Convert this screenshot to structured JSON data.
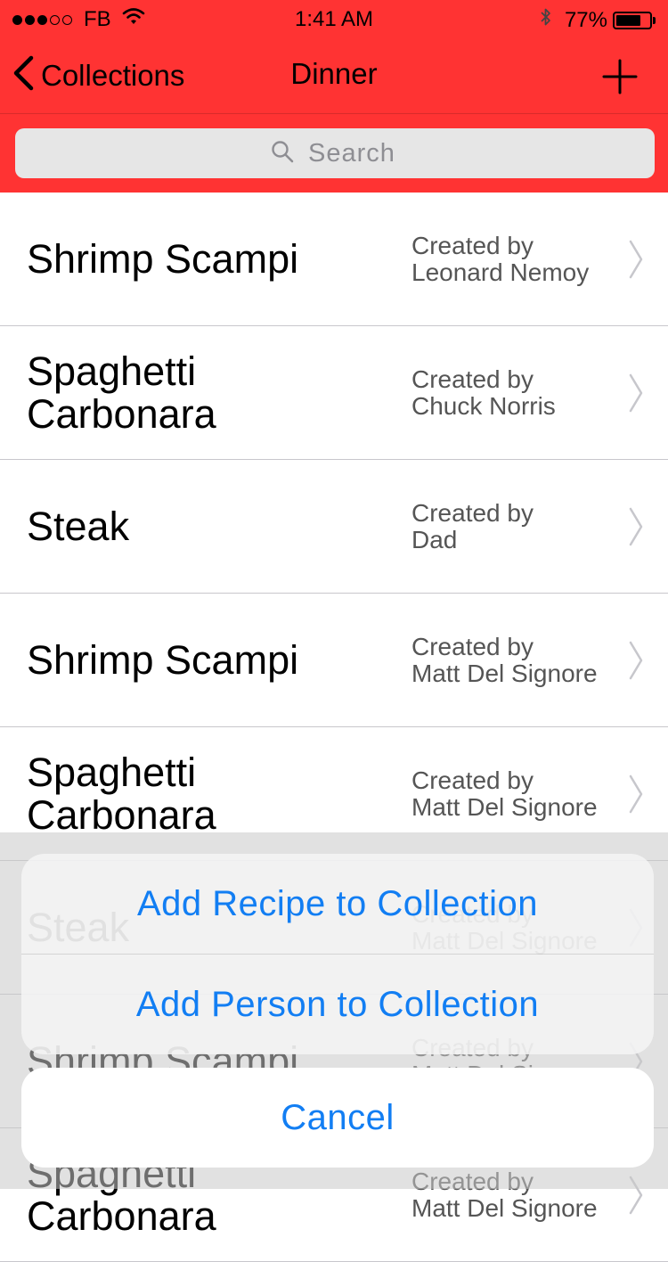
{
  "status_bar": {
    "carrier": "FB",
    "time": "1:41 AM",
    "battery_percent": "77%",
    "battery_level": 0.77,
    "signal_bars_filled": 3,
    "signal_bars_total": 5
  },
  "nav": {
    "back_label": "Collections",
    "title": "Dinner",
    "add_icon": "plus-icon"
  },
  "search": {
    "placeholder": "Search"
  },
  "recipes": [
    {
      "name": "Shrimp Scampi",
      "author_line1": "Created by",
      "author_line2": "Leonard Nemoy"
    },
    {
      "name": "Spaghetti Carbonara",
      "author_line1": "Created by",
      "author_line2": "Chuck Norris"
    },
    {
      "name": "Steak",
      "author_line1": "Created by",
      "author_line2": "Dad"
    },
    {
      "name": "Shrimp Scampi",
      "author_line1": "Created by",
      "author_line2": "Matt Del Signore"
    },
    {
      "name": "Spaghetti Carbonara",
      "author_line1": "Created by",
      "author_line2": "Matt Del Signore"
    },
    {
      "name": "Steak",
      "author_line1": "Created by",
      "author_line2": "Matt Del Signore"
    },
    {
      "name": "Shrimp Scampi",
      "author_line1": "Created by",
      "author_line2": "Matt Del Signore"
    },
    {
      "name": "Spaghetti Carbonara",
      "author_line1": "Created by",
      "author_line2": "Matt Del Signore"
    }
  ],
  "action_sheet": {
    "add_recipe_label": "Add Recipe to Collection",
    "add_person_label": "Add Person to Collection",
    "cancel_label": "Cancel"
  },
  "colors": {
    "header_red": "#ff3333",
    "action_blue": "#127ef3"
  }
}
